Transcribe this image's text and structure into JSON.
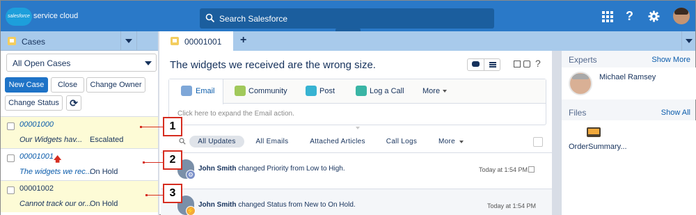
{
  "header": {
    "logo_text": "salesforce",
    "app_name": "service cloud",
    "search_placeholder": "Search Salesforce",
    "help_icon": "?"
  },
  "left_panel": {
    "title": "Cases",
    "list_view": "All Open Cases",
    "buttons": {
      "new_case": "New Case",
      "close": "Close",
      "change_owner": "Change Owner",
      "change_status": "Change Status"
    },
    "cases": [
      {
        "number": "00001000",
        "subject": "Our Widgets hav...",
        "status": "Escalated"
      },
      {
        "number": "00001001",
        "subject": "The widgets we rec...",
        "status": "On Hold"
      },
      {
        "number": "00001002",
        "subject": "Cannot track our or...",
        "status": "On Hold"
      }
    ]
  },
  "tabs": {
    "active_label": "00001001",
    "add": "+"
  },
  "main": {
    "case_title": "The widgets we received are the wrong size.",
    "help": "?",
    "publisher": {
      "actions": [
        "Email",
        "Community",
        "Post",
        "Log a Call",
        "More"
      ],
      "expand_hint": "Click here to expand the Email action."
    },
    "filters": [
      "All Updates",
      "All Emails",
      "Attached Articles",
      "Call Logs",
      "More"
    ],
    "feed": [
      {
        "user": "John Smith",
        "text": "changed Priority from Low to High.",
        "time": "Today at 1:54 PM"
      },
      {
        "user": "John Smith",
        "text": "changed Status from New to On Hold.",
        "time": "Today at 1:54 PM"
      }
    ]
  },
  "right_panel": {
    "experts_title": "Experts",
    "experts_link": "Show More",
    "expert_name": "Michael Ramsey",
    "files_title": "Files",
    "files_link": "Show All",
    "file_name": "OrderSummary..."
  },
  "callouts": [
    "1",
    "2",
    "3"
  ],
  "colors": {
    "header": "#2a79c8",
    "tab_strip": "#a8caeb",
    "primary_button": "#1e73c7",
    "callout": "#d62d20",
    "highlight_row": "#fdfbd6"
  }
}
